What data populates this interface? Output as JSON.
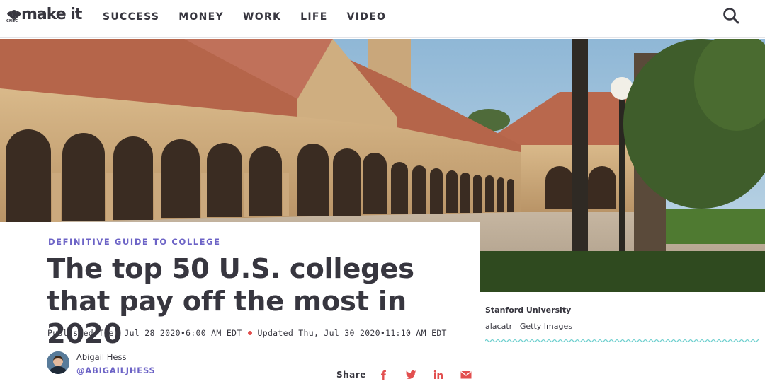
{
  "header": {
    "logo_small": "CNBC",
    "logo_text": "make it",
    "nav": [
      "SUCCESS",
      "MONEY",
      "WORK",
      "LIFE",
      "VIDEO"
    ],
    "search_icon": "search-icon"
  },
  "article": {
    "kicker": "DEFINITIVE GUIDE TO COLLEGE",
    "headline": "The top 50 U.S. colleges that pay off the most in 2020",
    "published": "Published Tue, Jul 28 2020•6:00 AM EDT",
    "updated": "Updated Thu, Jul 30 2020•11:10 AM EDT",
    "author_name": "Abigail Hess",
    "author_handle": "@ABIGAILJHESS",
    "share_label": "Share",
    "share_icons": [
      "facebook-icon",
      "twitter-icon",
      "linkedin-icon",
      "email-icon"
    ]
  },
  "image_caption": {
    "title": "Stanford University",
    "credit": "alacatr | Getty Images"
  },
  "colors": {
    "accent": "#6c63c6",
    "text": "#37363f",
    "share_red": "#e24f4f",
    "wave": "#6fd0cf"
  }
}
